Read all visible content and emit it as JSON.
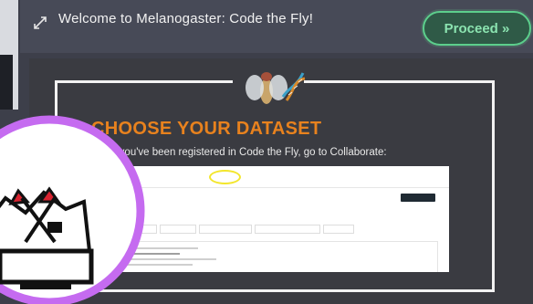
{
  "header": {
    "title": "Welcome to Melanogaster: Code the Fly!",
    "proceed_label": "Proceed »"
  },
  "slide": {
    "heading": "CHOOSE YOUR DATASET",
    "instruction": "Once you've been registered in Code the Fly, go to Collaborate:"
  },
  "colors": {
    "header_bg": "#474a57",
    "panel_bg": "#3a3b41",
    "heading": "#e8821e",
    "proceed": "#5ccf8c",
    "highlight": "#f3e62c",
    "badge_ring": "#c56bf0"
  },
  "icons": {
    "expand": "expand-icon",
    "fly": "fly-dna-icon",
    "logo": "code-the-fly-logo"
  }
}
